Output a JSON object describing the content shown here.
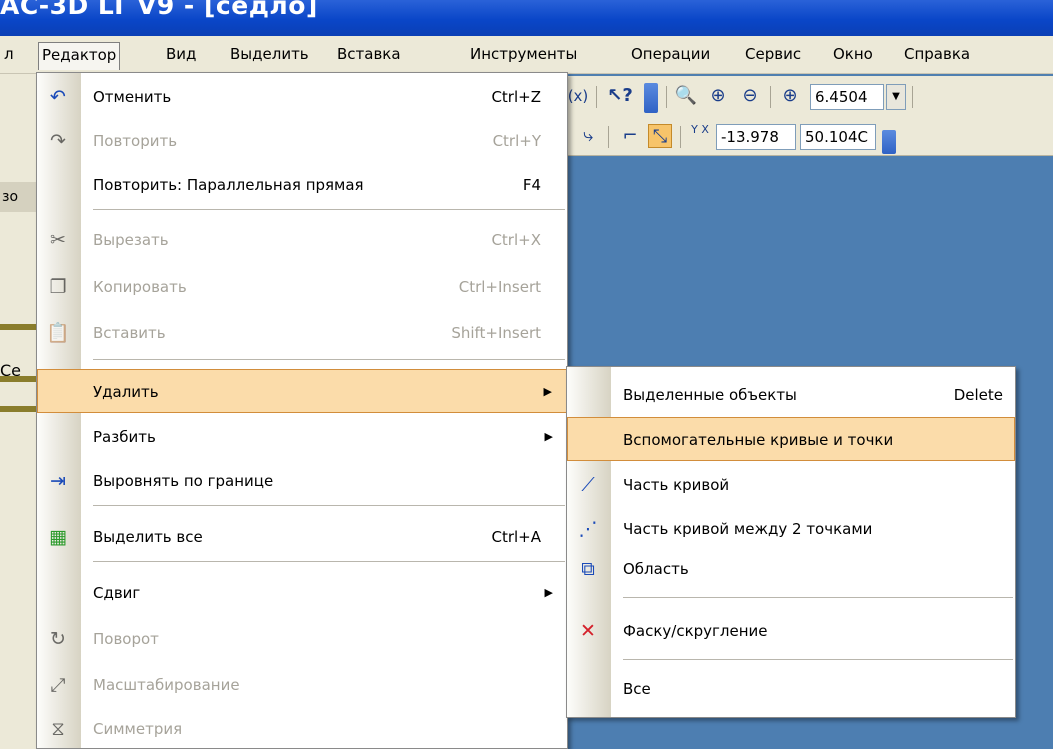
{
  "window": {
    "title": "АС-3D LT V9 - [седло]"
  },
  "menubar": {
    "items": [
      {
        "label": "л"
      },
      {
        "label": "Редактор"
      },
      {
        "label": "Вид"
      },
      {
        "label": "Выделить"
      },
      {
        "label": "Вставка"
      },
      {
        "label": "Инструменты"
      },
      {
        "label": "Операции"
      },
      {
        "label": "Сервис"
      },
      {
        "label": "Окно"
      },
      {
        "label": "Справка"
      }
    ]
  },
  "toolbar": {
    "zoom_value": "6.4504",
    "coord_x": "-13.978",
    "coord_y": "50.104C",
    "xy_label": "Y X"
  },
  "left_panel": {
    "header": "зо",
    "label": "Се"
  },
  "edit_menu": {
    "items": [
      {
        "label": "Отменить",
        "shortcut": "Ctrl+Z",
        "icon": "undo-icon",
        "glyph": "↶"
      },
      {
        "label": "Повторить",
        "shortcut": "Ctrl+Y",
        "icon": "redo-icon",
        "glyph": "↷"
      },
      {
        "label": "Повторить: Параллельная прямая",
        "shortcut": "F4"
      },
      {
        "label": "Вырезать",
        "shortcut": "Ctrl+X",
        "icon": "cut-icon",
        "glyph": "✂"
      },
      {
        "label": "Копировать",
        "shortcut": "Ctrl+Insert",
        "icon": "copy-icon",
        "glyph": "❐"
      },
      {
        "label": "Вставить",
        "shortcut": "Shift+Insert",
        "icon": "paste-icon",
        "glyph": "📋"
      },
      {
        "label": "Удалить",
        "shortcut": ""
      },
      {
        "label": "Разбить",
        "shortcut": ""
      },
      {
        "label": "Выровнять по границе",
        "shortcut": "",
        "icon": "align-border-icon",
        "glyph": "⇥"
      },
      {
        "label": "Выделить все",
        "shortcut": "Ctrl+A",
        "icon": "select-all-icon",
        "glyph": "▦"
      },
      {
        "label": "Сдвиг",
        "shortcut": ""
      },
      {
        "label": "Поворот",
        "shortcut": "",
        "icon": "rotate-icon",
        "glyph": "↻"
      },
      {
        "label": "Масштабирование",
        "shortcut": "",
        "icon": "scale-icon",
        "glyph": "⤢"
      },
      {
        "label": "Симметрия",
        "shortcut": "",
        "icon": "symmetry-icon",
        "glyph": "⧖"
      }
    ]
  },
  "delete_submenu": {
    "items": [
      {
        "label": "Выделенные объекты",
        "shortcut": "Delete"
      },
      {
        "label": "Вспомогательные кривые и точки",
        "shortcut": ""
      },
      {
        "label": "Часть кривой",
        "icon": "curve-part-icon",
        "glyph": "⟋"
      },
      {
        "label": "Часть кривой между 2 точками",
        "icon": "curve-between-points-icon",
        "glyph": "⋰"
      },
      {
        "label": "Область",
        "icon": "region-icon",
        "glyph": "⧉"
      },
      {
        "label": "Фаску/скругление",
        "icon": "chamfer-delete-icon",
        "glyph": "✕"
      },
      {
        "label": "Все"
      }
    ]
  },
  "colors": {
    "highlight": "#fbdcaa",
    "title_bar": "#0a46c8",
    "canvas": "#4d7eb1"
  }
}
